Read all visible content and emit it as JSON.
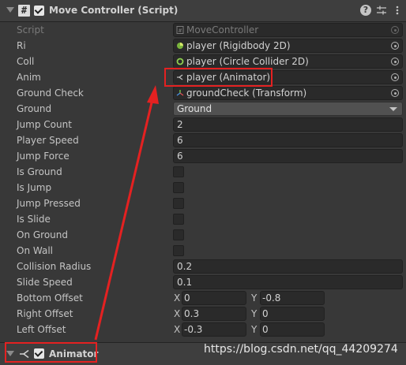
{
  "header": {
    "title": "Move Controller (Script)",
    "enabled": true,
    "help_icon": "help-icon",
    "presets_icon": "presets-icon",
    "menu_icon": "kebab-menu-icon"
  },
  "fields": {
    "script": {
      "label": "Script",
      "value": "MoveController",
      "icon": "script-file-icon"
    },
    "ri": {
      "label": "Ri",
      "value": "player (Rigidbody 2D)",
      "icon": "rigidbody2d-icon"
    },
    "coll": {
      "label": "Coll",
      "value": "player (Circle Collider 2D)",
      "icon": "circle-collider-icon"
    },
    "anim": {
      "label": "Anim",
      "value": "player (Animator)",
      "icon": "animator-icon"
    },
    "ground_check": {
      "label": "Ground Check",
      "value": "groundCheck (Transform)",
      "icon": "transform-icon"
    },
    "ground": {
      "label": "Ground",
      "value": "Ground"
    },
    "jump_count": {
      "label": "Jump Count",
      "value": "2"
    },
    "player_speed": {
      "label": "Player Speed",
      "value": "6"
    },
    "jump_force": {
      "label": "Jump Force",
      "value": "6"
    },
    "is_ground": {
      "label": "Is Ground",
      "checked": false
    },
    "is_jump": {
      "label": "Is Jump",
      "checked": false
    },
    "jump_pressed": {
      "label": "Jump Pressed",
      "checked": false
    },
    "is_slide": {
      "label": "Is Slide",
      "checked": false
    },
    "on_ground": {
      "label": "On Ground",
      "checked": false
    },
    "on_wall": {
      "label": "On Wall",
      "checked": false
    },
    "collision_radius": {
      "label": "Collision Radius",
      "value": "0.2"
    },
    "slide_speed": {
      "label": "Slide Speed",
      "value": "0.1"
    },
    "bottom_offset": {
      "label": "Bottom Offset",
      "x_label": "X",
      "x": "0",
      "y_label": "Y",
      "y": "-0.8"
    },
    "right_offset": {
      "label": "Right Offset",
      "x_label": "X",
      "x": "0.3",
      "y_label": "Y",
      "y": "0"
    },
    "left_offset": {
      "label": "Left Offset",
      "x_label": "X",
      "x": "-0.3",
      "y_label": "Y",
      "y": "0"
    }
  },
  "animator_component": {
    "title": "Animator",
    "enabled": true,
    "icon": "animator-icon"
  },
  "annotation": {
    "watermark": "https://blog.csdn.net/qq_44209274",
    "highlight_color": "#e42121"
  }
}
